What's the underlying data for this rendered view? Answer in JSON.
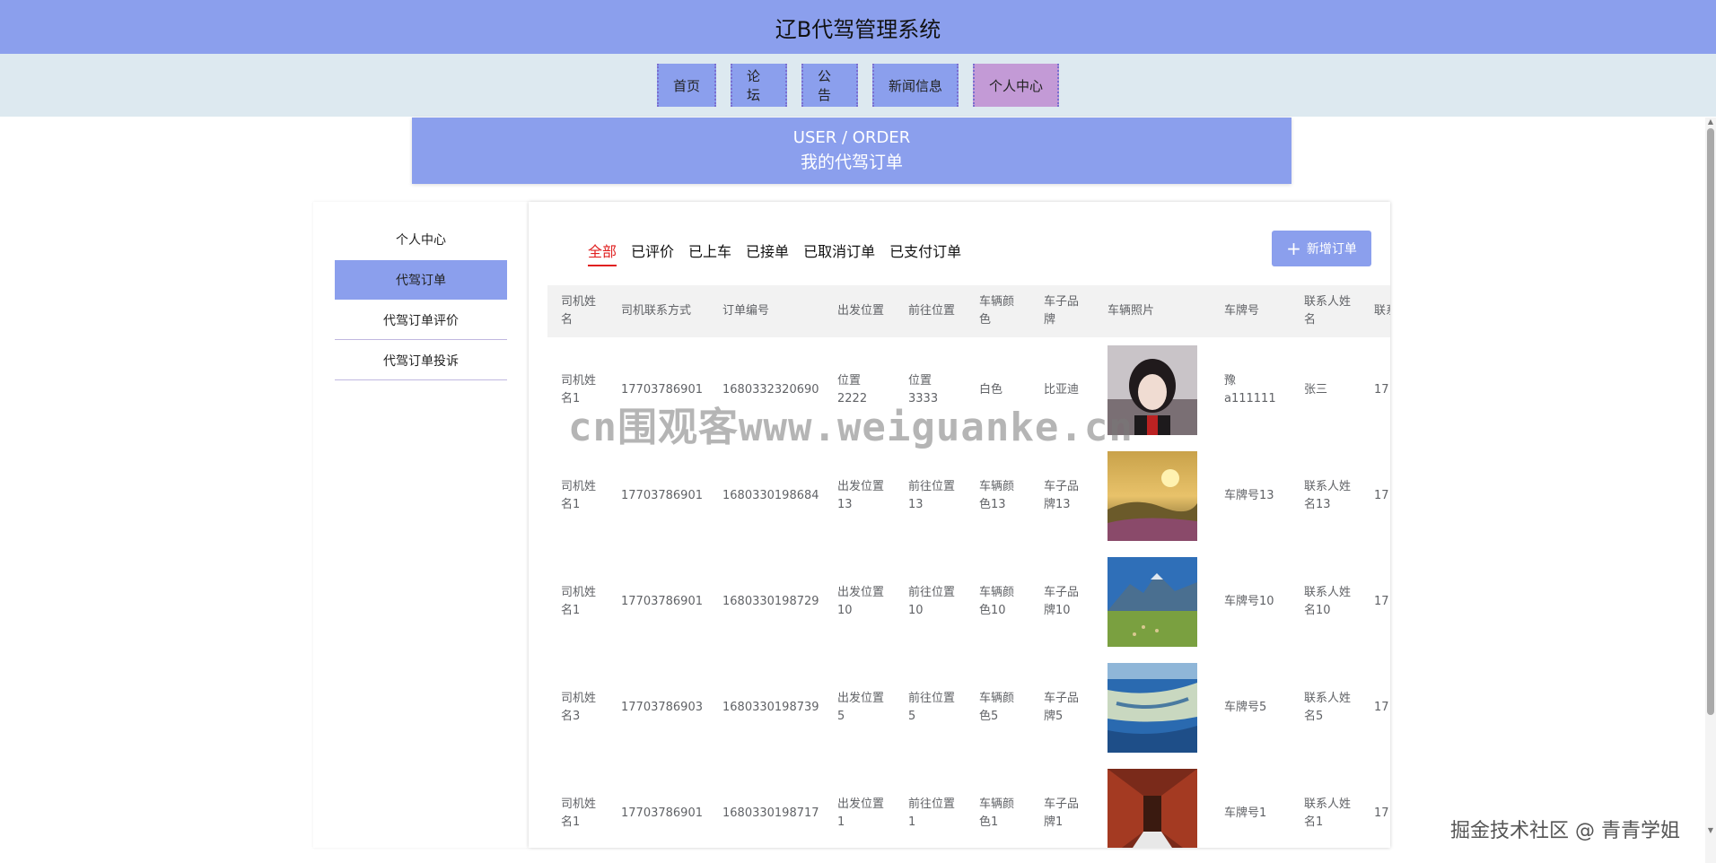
{
  "header": {
    "title": "辽B代驾管理系统"
  },
  "nav": [
    {
      "label": "首页"
    },
    {
      "label": "论坛"
    },
    {
      "label": "公告"
    },
    {
      "label": "新闻信息"
    },
    {
      "label": "个人中心"
    }
  ],
  "banner": {
    "en": "USER / ORDER",
    "cn": "我的代驾订单"
  },
  "sidebar": {
    "items": [
      {
        "label": "个人中心"
      },
      {
        "label": "代驾订单"
      },
      {
        "label": "代驾订单评价"
      },
      {
        "label": "代驾订单投诉"
      }
    ]
  },
  "tabs": [
    {
      "label": "全部"
    },
    {
      "label": "已评价"
    },
    {
      "label": "已上车"
    },
    {
      "label": "已接单"
    },
    {
      "label": "已取消订单"
    },
    {
      "label": "已支付订单"
    }
  ],
  "add_button": {
    "label": "新增订单",
    "icon": "plus-icon"
  },
  "table": {
    "headers": [
      "司机姓名",
      "司机联系方式",
      "订单编号",
      "出发位置",
      "前往位置",
      "车辆颜色",
      "车子品牌",
      "车辆照片",
      "车牌号",
      "联系人姓名",
      "联系"
    ],
    "rows": [
      {
        "driver": "司机姓名1",
        "phone": "17703786901",
        "order_no": "1680332320690",
        "from": "位置2222",
        "to": "位置3333",
        "color": "白色",
        "brand": "比亚迪",
        "photo": "portrait",
        "plate": "豫a111111",
        "contact": "张三",
        "more": "17"
      },
      {
        "driver": "司机姓名1",
        "phone": "17703786901",
        "order_no": "1680330198684",
        "from": "出发位置13",
        "to": "前往位置13",
        "color": "车辆颜色13",
        "brand": "车子品牌13",
        "photo": "sunset-meadow",
        "plate": "车牌号13",
        "contact": "联系人姓名13",
        "more": "17"
      },
      {
        "driver": "司机姓名1",
        "phone": "17703786901",
        "order_no": "1680330198729",
        "from": "出发位置10",
        "to": "前往位置10",
        "color": "车辆颜色10",
        "brand": "车子品牌10",
        "photo": "mountain-field",
        "plate": "车牌号10",
        "contact": "联系人姓名10",
        "more": "17"
      },
      {
        "driver": "司机姓名3",
        "phone": "17703786903",
        "order_no": "1680330198739",
        "from": "出发位置5",
        "to": "前往位置5",
        "color": "车辆颜色5",
        "brand": "车子品牌5",
        "photo": "coastline",
        "plate": "车牌号5",
        "contact": "联系人姓名5",
        "more": "17"
      },
      {
        "driver": "司机姓名1",
        "phone": "17703786901",
        "order_no": "1680330198717",
        "from": "出发位置1",
        "to": "前往位置1",
        "color": "车辆颜色1",
        "brand": "车子品牌1",
        "photo": "corridor",
        "plate": "车牌号1",
        "contact": "联系人姓名1",
        "more": "17"
      }
    ]
  },
  "watermark": "cn围观客www.weiguanke.cn",
  "credit": "掘金技术社区 @ 青青学姐",
  "colors": {
    "primary": "#8b9fed",
    "active_nav": "#c39ad6",
    "nav_bar": "#dde9f0",
    "tab_active": "#e02020"
  }
}
